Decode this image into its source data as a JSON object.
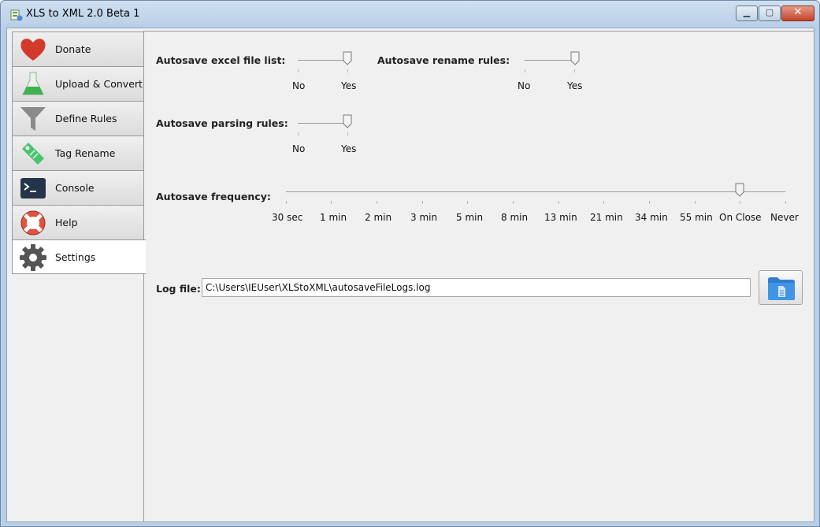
{
  "window": {
    "title": "XLS to XML 2.0 Beta 1"
  },
  "sidebar": {
    "items": [
      {
        "label": "Donate",
        "icon": "heart-icon",
        "color": "#d23a2e"
      },
      {
        "label": "Upload & Convert",
        "icon": "flask-icon",
        "color": "#3db050"
      },
      {
        "label": "Define Rules",
        "icon": "funnel-icon",
        "color": "#8a8a8a"
      },
      {
        "label": "Tag Rename",
        "icon": "tag-icon",
        "color": "#49c36d"
      },
      {
        "label": "Console",
        "icon": "terminal-icon",
        "color": "#24354a"
      },
      {
        "label": "Help",
        "icon": "lifebuoy-icon",
        "color": "#e1533d"
      },
      {
        "label": "Settings",
        "icon": "gear-icon",
        "color": "#555555",
        "active": true
      }
    ]
  },
  "settings": {
    "autosave_excel": {
      "label": "Autosave excel file list:",
      "options": [
        "No",
        "Yes"
      ],
      "value": "Yes"
    },
    "autosave_rename": {
      "label": "Autosave rename rules:",
      "options": [
        "No",
        "Yes"
      ],
      "value": "Yes"
    },
    "autosave_parsing": {
      "label": "Autosave parsing rules:",
      "options": [
        "No",
        "Yes"
      ],
      "value": "Yes"
    },
    "autosave_frequency": {
      "label": "Autosave frequency:",
      "options": [
        "30 sec",
        "1 min",
        "2 min",
        "3 min",
        "5 min",
        "8 min",
        "13 min",
        "21 min",
        "34 min",
        "55 min",
        "On Close",
        "Never"
      ],
      "value": "On Close"
    },
    "log_file": {
      "label": "Log file:",
      "value": "C:\\Users\\IEUser\\XLStoXML\\autosaveFileLogs.log"
    }
  },
  "colors": {
    "accent": "#2f7fd0",
    "titlebar": "#b9cfe7"
  }
}
